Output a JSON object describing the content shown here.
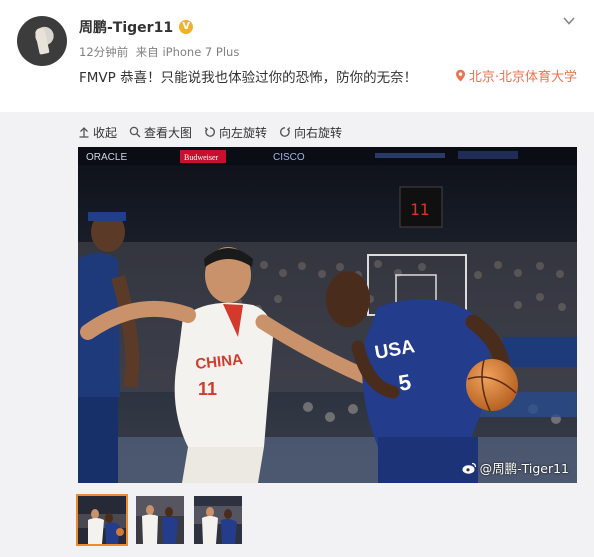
{
  "post": {
    "author": "周鹏-Tiger11",
    "time": "12分钟前",
    "source_prefix": "来自",
    "source": "iPhone 7 Plus",
    "text": "FMVP 恭喜！只能说我也体验过你的恐怖，防你的无奈！",
    "location": "北京·北京体育大学"
  },
  "toolbar": {
    "collapse_label": "收起",
    "view_large_label": "查看大图",
    "rotate_left_label": "向左旋转",
    "rotate_right_label": "向右旋转"
  },
  "photo": {
    "watermark": "@周鹏-Tiger11",
    "jersey_china": "CHINA",
    "jersey_china_number": "11",
    "jersey_usa": "USA",
    "jersey_usa_number": "5",
    "shot_clock": "11",
    "court_ad_1": "ORACLE",
    "court_ad_2": "Budweiser",
    "court_ad_3": "CISCO"
  },
  "icons": [
    "verified-badge-icon",
    "chevron-down-icon",
    "location-pin-icon",
    "collapse-arrow-icon",
    "magnifier-icon",
    "rotate-left-icon",
    "rotate-right-icon",
    "weibo-logo-icon"
  ],
  "colors": {
    "accent": "#eb7350",
    "verified": "#f0b22a",
    "active_thumb_border": "#f08a30",
    "panel_bg": "#f2f2f5"
  },
  "thumbnails": {
    "count": 3,
    "active_index": 0
  }
}
